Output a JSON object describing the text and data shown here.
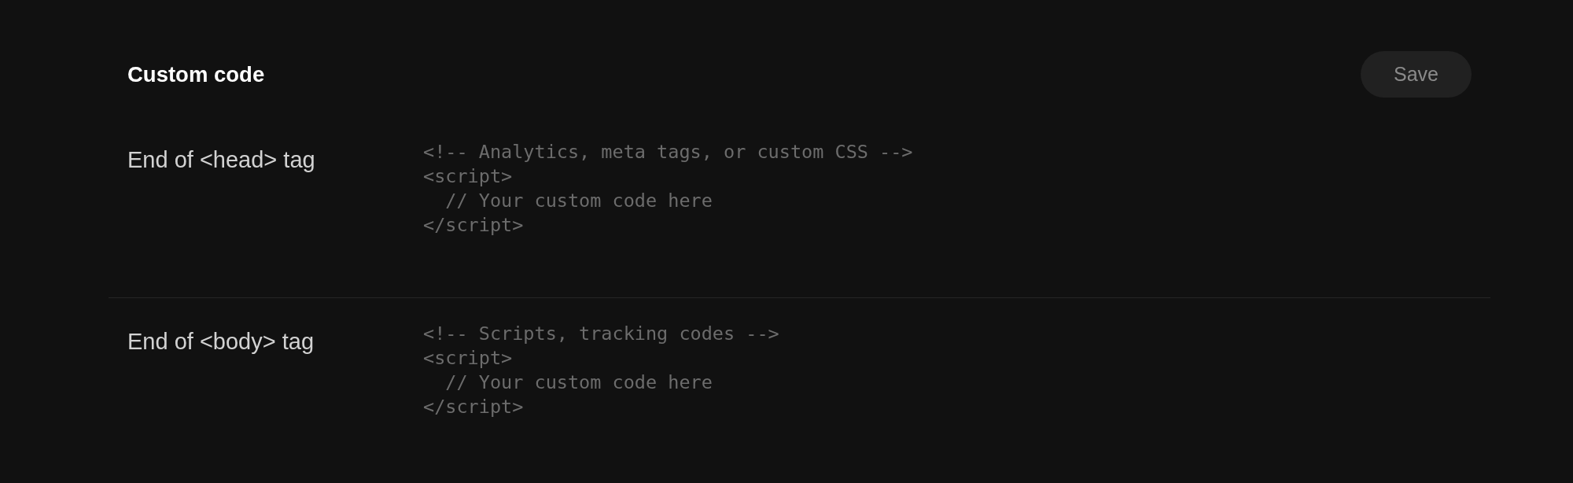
{
  "header": {
    "title": "Custom code",
    "save_button": {
      "label": "Save",
      "disabled": true
    }
  },
  "sections": [
    {
      "label": "End of <head> tag",
      "editor": {
        "placeholder": "<!-- Analytics, meta tags, or custom CSS -->\n<script>\n  // Your custom code here\n</script>"
      }
    },
    {
      "label": "End of <body> tag",
      "editor": {
        "placeholder": "<!-- Scripts, tracking codes -->\n<script>\n  // Your custom code here\n</script>"
      }
    }
  ]
}
